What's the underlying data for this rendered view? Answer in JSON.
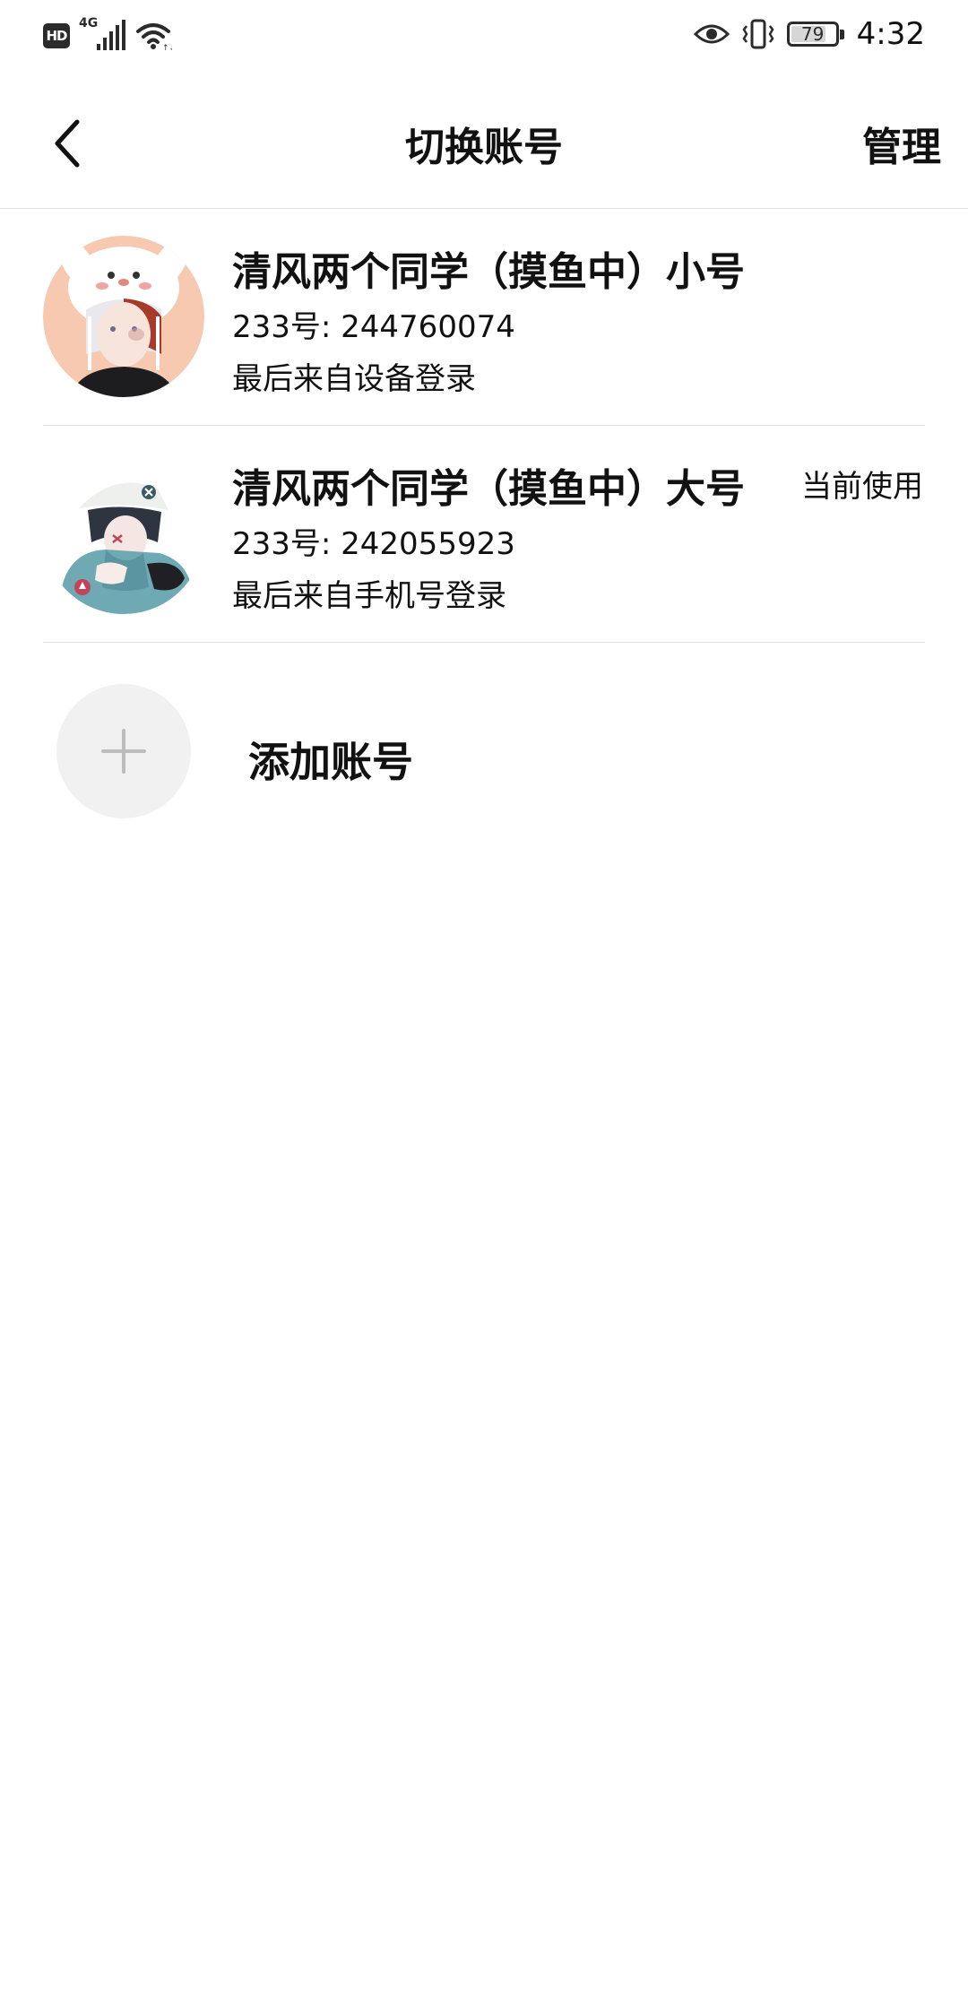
{
  "status_bar": {
    "hd_label": "HD",
    "network_label": "4G",
    "battery_level": "79",
    "battery_fraction": 0.79,
    "time": "4:32",
    "icons": [
      "hd-icon",
      "signal-icon",
      "wifi-icon",
      "eye-icon",
      "vibrate-icon",
      "battery-icon"
    ]
  },
  "header": {
    "title": "切换账号",
    "manage_label": "管理",
    "back_icon": "chevron-left-icon"
  },
  "accounts": [
    {
      "name": "清风两个同学（摸鱼中）小号",
      "id_text": "233号: 244760074",
      "login_text": "最后来自设备登录",
      "current_label": "",
      "avatar_colors": {
        "bg": "#f6c9b0",
        "accent": "#a83a2a"
      }
    },
    {
      "name": "清风两个同学（摸鱼中）大号",
      "id_text": "233号: 242055923",
      "login_text": "最后来自手机号登录",
      "current_label": "当前使用",
      "avatar_colors": {
        "bg": "#ffffff",
        "accent": "#5f9eab"
      }
    }
  ],
  "add_account": {
    "label": "添加账号",
    "icon": "plus-icon"
  },
  "colors": {
    "text": "#111111",
    "divider": "#e2e2e2",
    "add_circle": "#f1f1f1",
    "plus": "#bdbdbd"
  }
}
